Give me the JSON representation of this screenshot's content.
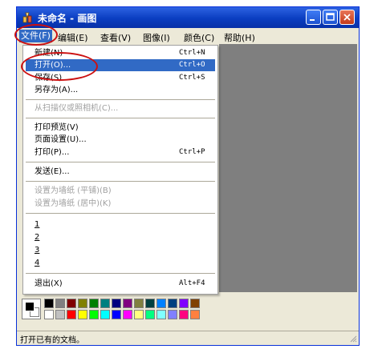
{
  "window": {
    "title": "未命名 - 画图"
  },
  "menubar": {
    "items": [
      "文件(F)",
      "编辑(E)",
      "查看(V)",
      "图像(I)",
      "颜色(C)",
      "帮助(H)"
    ]
  },
  "file_menu": {
    "items": [
      {
        "label": "新建(N)",
        "shortcut": "Ctrl+N"
      },
      {
        "label": "打开(O)...",
        "shortcut": "Ctrl+O"
      },
      {
        "label": "保存(S)",
        "shortcut": "Ctrl+S"
      },
      {
        "label": "另存为(A)..."
      },
      {
        "label": "从扫描仪或照相机(C)..."
      },
      {
        "label": "打印预览(V)"
      },
      {
        "label": "页面设置(U)..."
      },
      {
        "label": "打印(P)...",
        "shortcut": "Ctrl+P"
      },
      {
        "label": "发送(E)..."
      },
      {
        "label": "设置为墙纸 (平铺)(B)"
      },
      {
        "label": "设置为墙纸 (居中)(K)"
      },
      {
        "label": "1"
      },
      {
        "label": "2"
      },
      {
        "label": "3"
      },
      {
        "label": "4"
      },
      {
        "label": "退出(X)",
        "shortcut": "Alt+F4"
      }
    ]
  },
  "palette": {
    "top_row": [
      "#000000",
      "#808080",
      "#800000",
      "#808000",
      "#008000",
      "#008080",
      "#000080",
      "#800080",
      "#808040",
      "#004040",
      "#0080ff",
      "#004080",
      "#8000ff",
      "#804000"
    ],
    "bottom_row": [
      "#ffffff",
      "#c0c0c0",
      "#ff0000",
      "#ffff00",
      "#00ff00",
      "#00ffff",
      "#0000ff",
      "#ff00ff",
      "#ffff80",
      "#00ff80",
      "#80ffff",
      "#8080ff",
      "#ff0080",
      "#ff8040"
    ]
  },
  "statusbar": {
    "text": "打开已有的文档。"
  },
  "colors": {
    "highlight": "#316ac5",
    "annotation_ring": "#cc1010"
  }
}
